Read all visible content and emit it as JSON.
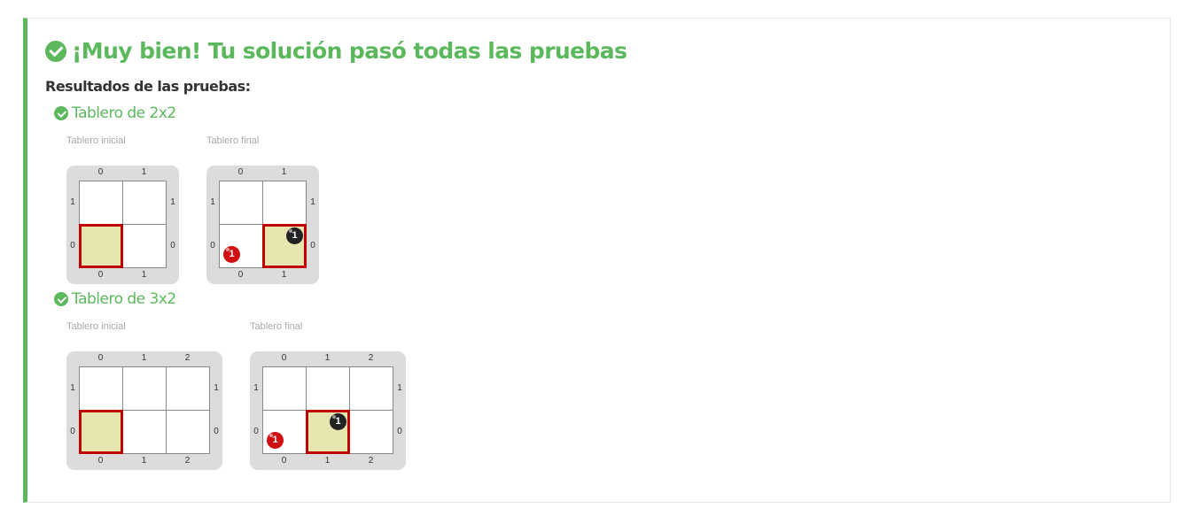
{
  "headline": "¡Muy bien! Tu solución pasó todas las pruebas",
  "results_title": "Resultados de las pruebas:",
  "tests": [
    {
      "title": "Tablero de 2x2",
      "initial": {
        "label": "Tablero inicial",
        "cols": [
          "0",
          "1"
        ],
        "rows": [
          "1",
          "0"
        ],
        "head": {
          "col": 0,
          "row": 0
        },
        "cells": []
      },
      "final": {
        "label": "Tablero final",
        "cols": [
          "0",
          "1"
        ],
        "rows": [
          "1",
          "0"
        ],
        "head": {
          "col": 1,
          "row": 0
        },
        "cells": [
          {
            "col": 0,
            "row": 0,
            "color": "red",
            "count": "1"
          },
          {
            "col": 1,
            "row": 0,
            "color": "black",
            "count": "1"
          }
        ]
      }
    },
    {
      "title": "Tablero de 3x2",
      "initial": {
        "label": "Tablero inicial",
        "cols": [
          "0",
          "1",
          "2"
        ],
        "rows": [
          "1",
          "0"
        ],
        "head": {
          "col": 0,
          "row": 0
        },
        "cells": []
      },
      "final": {
        "label": "Tablero final",
        "cols": [
          "0",
          "1",
          "2"
        ],
        "rows": [
          "1",
          "0"
        ],
        "head": {
          "col": 1,
          "row": 0
        },
        "cells": [
          {
            "col": 0,
            "row": 0,
            "color": "red",
            "count": "1"
          },
          {
            "col": 1,
            "row": 0,
            "color": "black",
            "count": "1"
          }
        ]
      }
    }
  ],
  "colors": {
    "success": "#5cb85c",
    "head_border": "#c00000",
    "head_fill": "#e8e6b0",
    "ball_red": "#d01010",
    "ball_black": "#222222"
  }
}
